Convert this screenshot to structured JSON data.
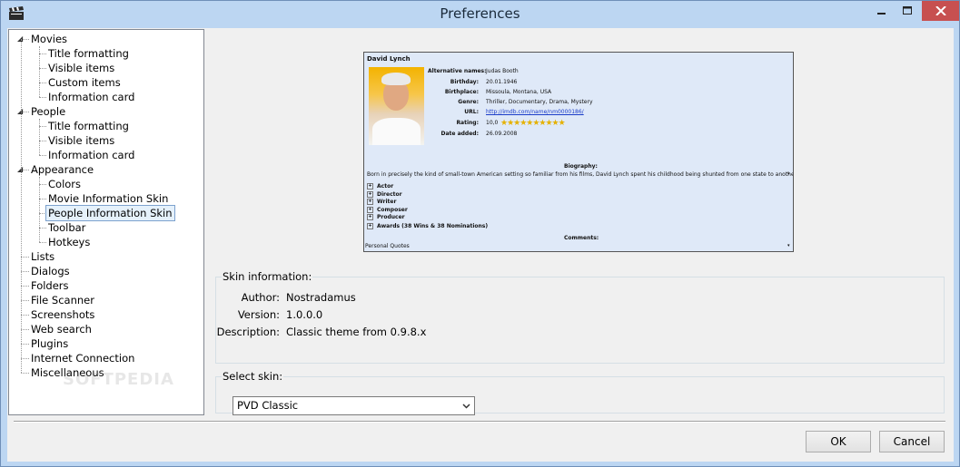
{
  "window": {
    "title": "Preferences",
    "icon": "clapperboard-icon",
    "controls": [
      "minimize-icon",
      "maximize-icon",
      "close-icon"
    ]
  },
  "tree": [
    {
      "label": "Movies",
      "expanded": true,
      "children": [
        "Title formatting",
        "Visible items",
        "Custom items",
        "Information card"
      ]
    },
    {
      "label": "People",
      "expanded": true,
      "children": [
        "Title formatting",
        "Visible items",
        "Information card"
      ]
    },
    {
      "label": "Appearance",
      "expanded": true,
      "children": [
        "Colors",
        "Movie Information Skin",
        "People Information Skin",
        "Toolbar",
        "Hotkeys"
      ]
    },
    {
      "label": "Lists"
    },
    {
      "label": "Dialogs"
    },
    {
      "label": "Folders"
    },
    {
      "label": "File Scanner"
    },
    {
      "label": "Screenshots"
    },
    {
      "label": "Web search"
    },
    {
      "label": "Plugins"
    },
    {
      "label": "Internet Connection"
    },
    {
      "label": "Miscellaneous"
    }
  ],
  "selected": "People Information Skin",
  "preview": {
    "name": "David Lynch",
    "fields": [
      {
        "label": "Alternative names:",
        "value": "Judas Booth"
      },
      {
        "label": "Birthday:",
        "value": "20.01.1946"
      },
      {
        "label": "Birthplace:",
        "value": "Missoula, Montana, USA"
      },
      {
        "label": "Genre:",
        "value": "Thriller, Documentary, Drama, Mystery"
      },
      {
        "label": "URL:",
        "value": "http://imdb.com/name/nm0000186/"
      },
      {
        "label": "Rating:",
        "value": "10,0"
      },
      {
        "label": "Date added:",
        "value": "26.09.2008"
      }
    ],
    "rating_stars": 10,
    "biography_heading": "Biography:",
    "biography_text": "Born in precisely the kind of small-town American setting so familiar from his films, David Lynch spent his childhood being shunted from one state to another as his",
    "roles": [
      "Actor",
      "Director",
      "Writer",
      "Composer",
      "Producer"
    ],
    "awards": "Awards (38 Wins & 38 Nominations)",
    "comments_heading": "Comments:",
    "personal_quotes": "Personal Quotes"
  },
  "skin_info": {
    "group_label": "Skin information:",
    "author_label": "Author:",
    "author": "Nostradamus",
    "version_label": "Version:",
    "version": "1.0.0.0",
    "description_label": "Description:",
    "description": "Classic theme from 0.9.8.x"
  },
  "select_skin": {
    "group_label": "Select skin:",
    "value": "PVD Classic"
  },
  "buttons": {
    "ok": "OK",
    "cancel": "Cancel"
  }
}
